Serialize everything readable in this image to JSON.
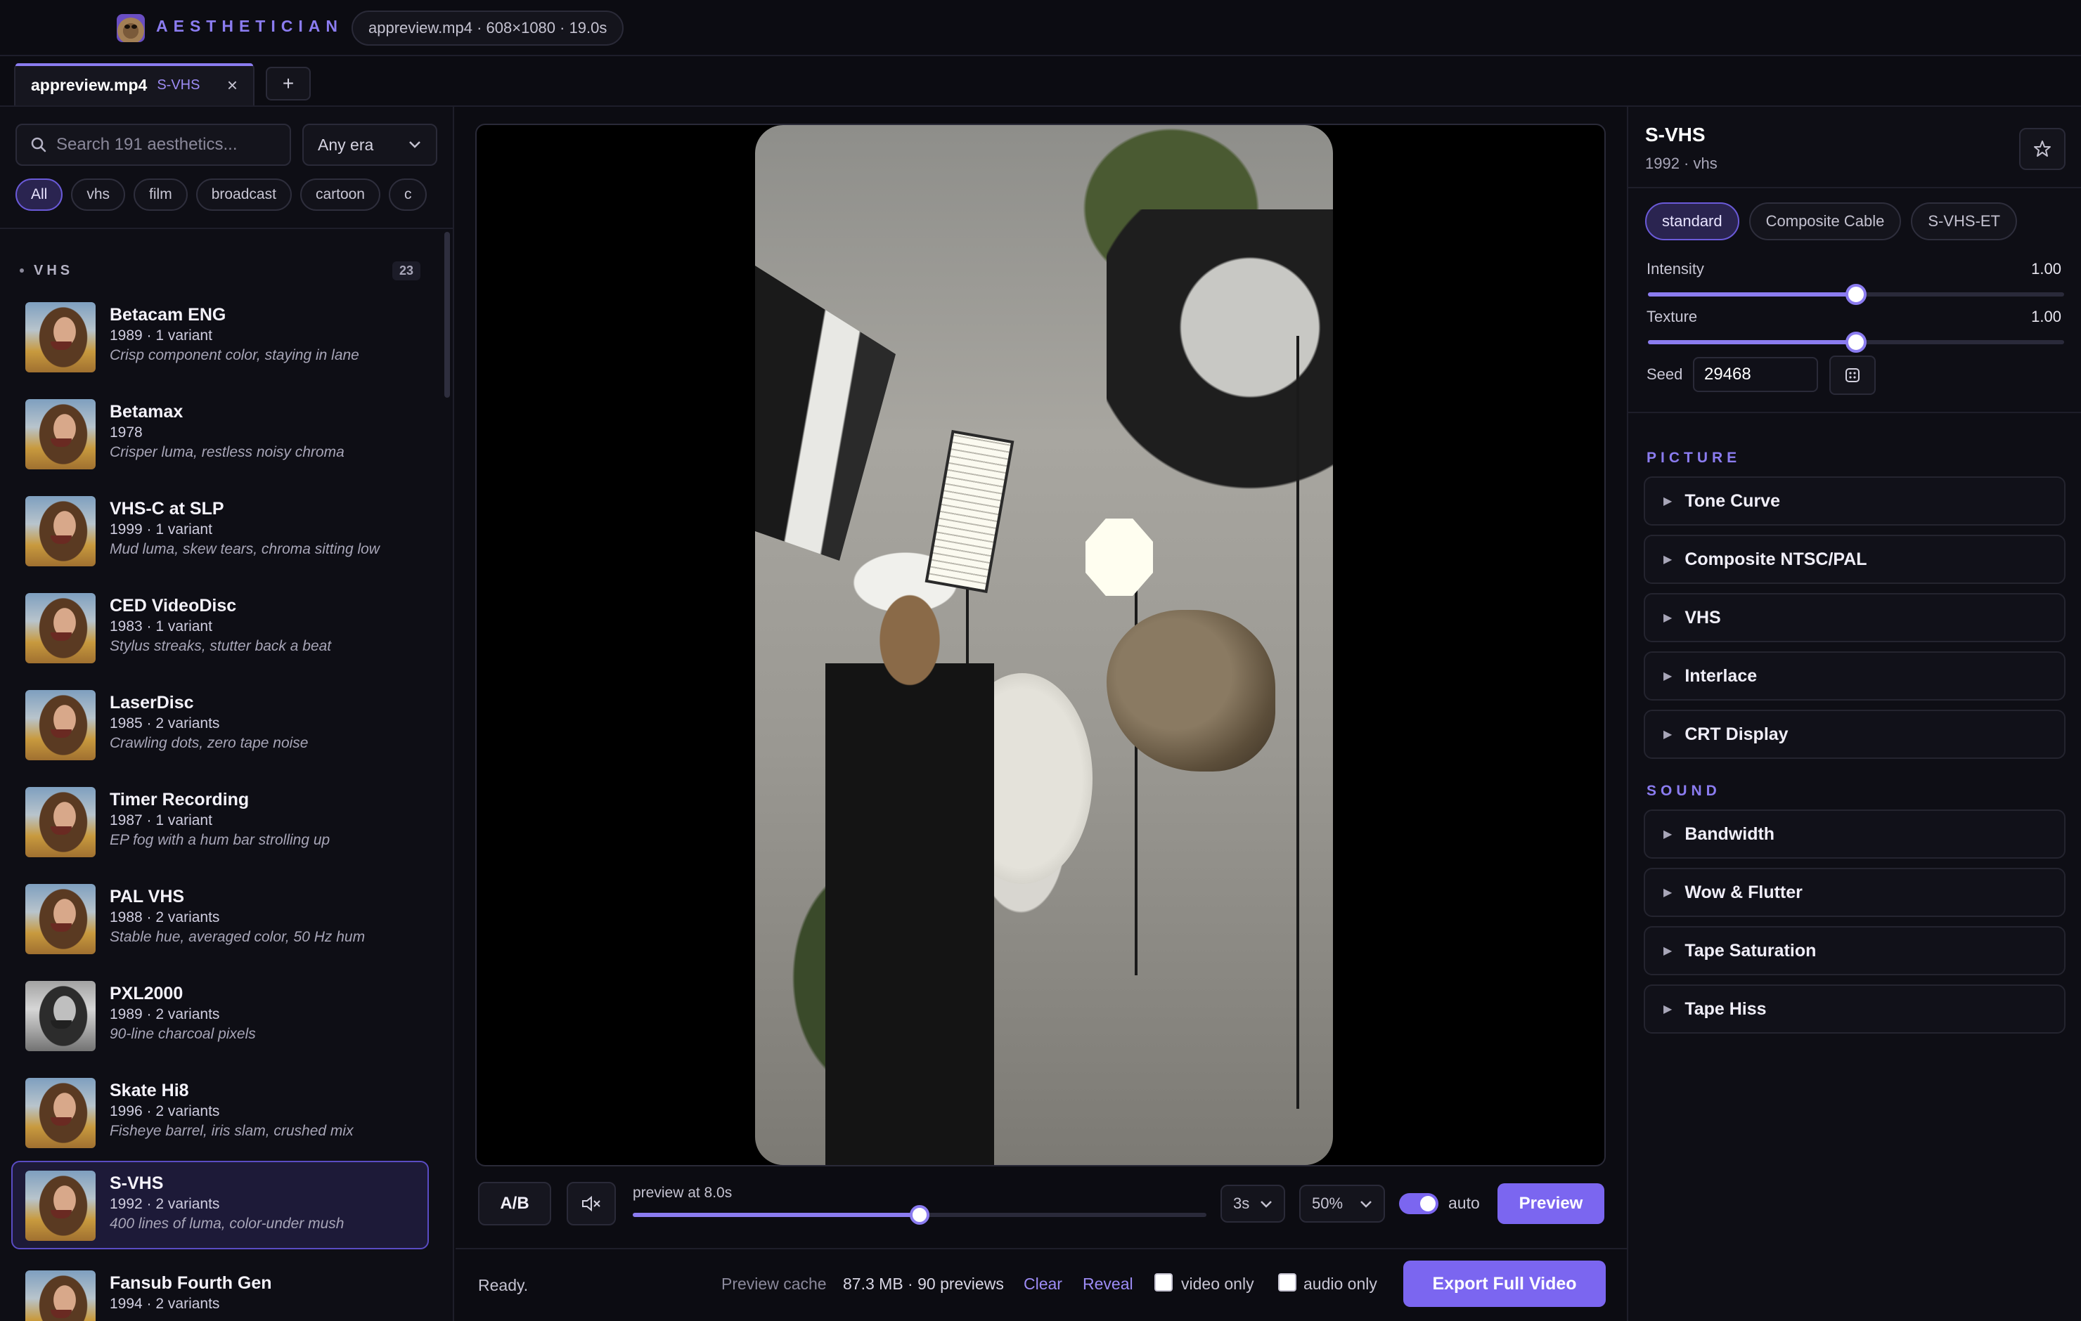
{
  "header": {
    "brand": "AESTHETICIAN",
    "file_info": "appreview.mp4 · 608×1080 · 19.0s"
  },
  "tabs": {
    "items": [
      {
        "title": "appreview.mp4",
        "badge": "S-VHS",
        "close": "×"
      }
    ],
    "add_label": "+"
  },
  "sidebar": {
    "search_placeholder": "Search 191 aesthetics...",
    "era_select": "Any era",
    "chips": [
      "All",
      "vhs",
      "film",
      "broadcast",
      "cartoon",
      "c"
    ],
    "section": {
      "title": "VHS",
      "count": "23"
    },
    "items": [
      {
        "title": "Betacam ENG",
        "meta": "1989 · 1 variant",
        "desc": "Crisp component color, staying in lane"
      },
      {
        "title": "Betamax",
        "meta": "1978",
        "desc": "Crisper luma, restless noisy chroma"
      },
      {
        "title": "VHS-C at SLP",
        "meta": "1999 · 1 variant",
        "desc": "Mud luma, skew tears, chroma sitting low"
      },
      {
        "title": "CED VideoDisc",
        "meta": "1983 · 1 variant",
        "desc": "Stylus streaks, stutter back a beat"
      },
      {
        "title": "LaserDisc",
        "meta": "1985 · 2 variants",
        "desc": "Crawling dots, zero tape noise"
      },
      {
        "title": "Timer Recording",
        "meta": "1987 · 1 variant",
        "desc": "EP fog with a hum bar strolling up"
      },
      {
        "title": "PAL VHS",
        "meta": "1988 · 2 variants",
        "desc": "Stable hue, averaged color, 50 Hz hum"
      },
      {
        "title": "PXL2000",
        "meta": "1989 · 2 variants",
        "desc": "90-line charcoal pixels"
      },
      {
        "title": "Skate Hi8",
        "meta": "1996 · 2 variants",
        "desc": "Fisheye barrel, iris slam, crushed mix"
      },
      {
        "title": "S-VHS",
        "meta": "1992 · 2 variants",
        "desc": "400 lines of luma, color-under mush"
      },
      {
        "title": "Fansub Fourth Gen",
        "meta": "1994 · 2 variants",
        "desc": ""
      }
    ]
  },
  "player": {
    "ab_label": "A/B",
    "preview_label": "preview at 8.0s",
    "progress": 0.5,
    "duration_select": "3s",
    "scale_select": "50%",
    "auto_label": "auto",
    "auto_on": true,
    "preview_button": "Preview"
  },
  "status": {
    "text": "Ready.",
    "cache_label": "Preview cache",
    "cache_value": "87.3 MB · 90 previews",
    "clear": "Clear",
    "reveal": "Reveal",
    "video_only": "video only",
    "audio_only": "audio only",
    "export": "Export Full Video"
  },
  "inspector": {
    "title": "S-VHS",
    "subtitle": "1992 · vhs",
    "variants": [
      "standard",
      "Composite Cable",
      "S-VHS-ET"
    ],
    "intensity": {
      "label": "Intensity",
      "value": "1.00",
      "fraction": 0.5
    },
    "texture": {
      "label": "Texture",
      "value": "1.00",
      "fraction": 0.5
    },
    "seed": {
      "label": "Seed",
      "value": "29468"
    },
    "picture_title": "PICTURE",
    "picture": [
      "Tone Curve",
      "Composite NTSC/PAL",
      "VHS",
      "Interlace",
      "CRT Display"
    ],
    "sound_title": "SOUND",
    "sound": [
      "Bandwidth",
      "Wow & Flutter",
      "Tape Saturation",
      "Tape Hiss"
    ]
  },
  "icons": [
    "logo-icon",
    "close-icon",
    "plus-icon",
    "search-icon",
    "chevron-down-icon",
    "mute-icon",
    "star-icon",
    "dice-icon",
    "triangle-right-icon"
  ],
  "colors": {
    "accent": "#7b66f0",
    "accent_light": "#8b7cf0",
    "background": "#0c0c12"
  }
}
